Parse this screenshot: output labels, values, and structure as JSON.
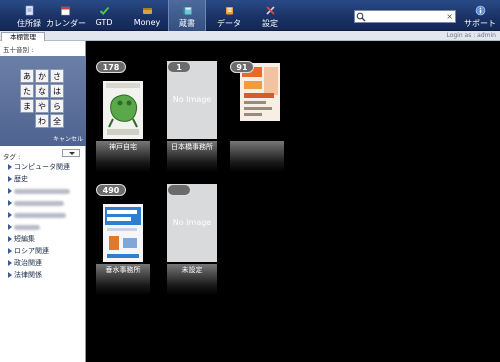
{
  "nav": {
    "items": [
      {
        "label": "住所録",
        "icon": "address-book-icon"
      },
      {
        "label": "カレンダー",
        "icon": "calendar-icon"
      },
      {
        "label": "GTD",
        "icon": "checkmark-icon"
      },
      {
        "label": "Money",
        "icon": "wallet-icon"
      },
      {
        "label": "蔵書",
        "icon": "book-icon",
        "active": true
      },
      {
        "label": "データ",
        "icon": "data-icon"
      },
      {
        "label": "設定",
        "icon": "tools-icon"
      }
    ],
    "support_label": "サポート",
    "search": {
      "value": "",
      "placeholder": "",
      "clear": "×"
    }
  },
  "subheader": {
    "tab": "本棚管理",
    "login": "Login as : admin"
  },
  "sidebar": {
    "gojuon_label": "五十音別 :",
    "kana": [
      "あ",
      "か",
      "さ",
      "た",
      "な",
      "は",
      "ま",
      "や",
      "ら",
      "",
      "わ",
      "全"
    ],
    "cancel": "キャンセル",
    "tag_label": "タグ :",
    "tags": [
      "コンピュータ関連",
      "歴史",
      "",
      "",
      "",
      "",
      "短編集",
      "ロシア関連",
      "政治関連",
      "法律関係"
    ]
  },
  "shelves": [
    {
      "name": "神戸自宅",
      "count": "178",
      "cover": "frog"
    },
    {
      "name": "日本橋事務所",
      "count": "1",
      "cover": "noimage",
      "noimage": "No Image"
    },
    {
      "name": "",
      "count": "91",
      "cover": "magazine"
    },
    {
      "name": "垂水事務所",
      "count": "490",
      "cover": "tech"
    },
    {
      "name": "未設定",
      "count": "",
      "cover": "noimage",
      "noimage": "No Image"
    }
  ],
  "colors": {
    "nav_bg": "#1a3165",
    "panel": "#5c709c",
    "main_bg": "#000000"
  }
}
